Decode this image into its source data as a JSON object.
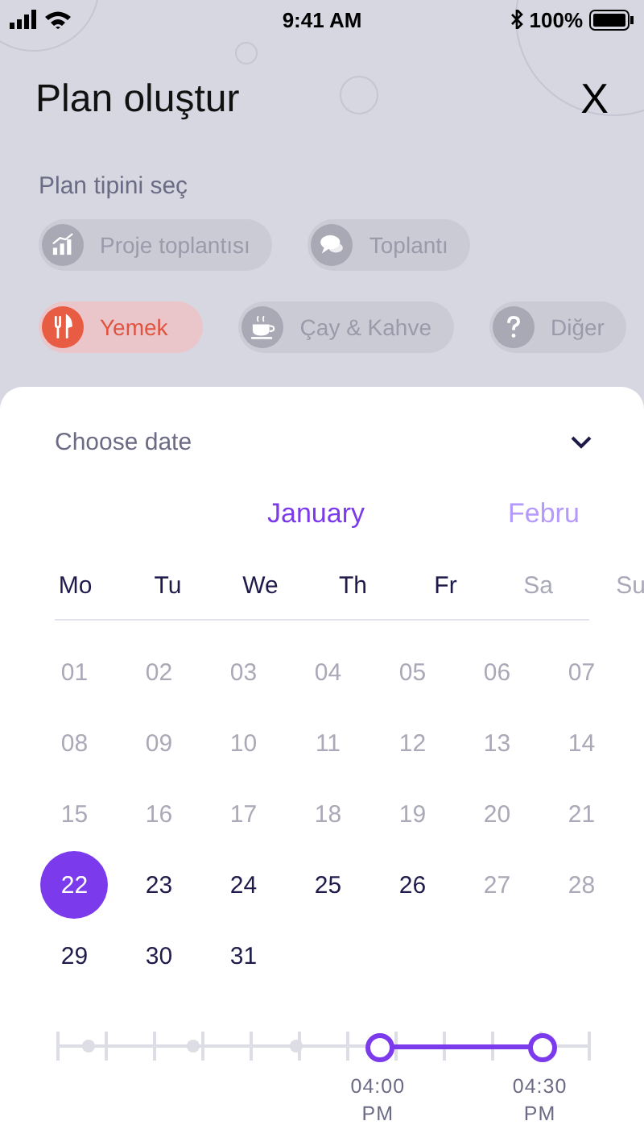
{
  "status_bar": {
    "time": "9:41 AM",
    "battery": "100%"
  },
  "header": {
    "title": "Plan oluştur",
    "close": "X"
  },
  "plan_type": {
    "label": "Plan tipini seç",
    "chips": [
      {
        "label": "Proje toplantısı",
        "kind": "chart",
        "selected": false
      },
      {
        "label": "Toplantı",
        "kind": "chat",
        "selected": false
      },
      {
        "label": "Yemek",
        "kind": "food",
        "selected": true
      },
      {
        "label": "Çay & Kahve",
        "kind": "cup",
        "selected": false
      },
      {
        "label": "Diğer",
        "kind": "other",
        "selected": false
      }
    ]
  },
  "date_sheet": {
    "title": "Choose date",
    "months": [
      {
        "label": "January",
        "selected": true
      },
      {
        "label": "Febru",
        "selected": false
      }
    ],
    "weekdays": [
      {
        "label": "Mo",
        "disabled": false
      },
      {
        "label": "Tu",
        "disabled": false
      },
      {
        "label": "We",
        "disabled": false
      },
      {
        "label": "Th",
        "disabled": false
      },
      {
        "label": "Fr",
        "disabled": false
      },
      {
        "label": "Sa",
        "disabled": true
      },
      {
        "label": "Su",
        "disabled": true
      }
    ],
    "days": [
      {
        "label": "01",
        "disabled": true,
        "selected": false
      },
      {
        "label": "02",
        "disabled": true,
        "selected": false
      },
      {
        "label": "03",
        "disabled": true,
        "selected": false
      },
      {
        "label": "04",
        "disabled": true,
        "selected": false
      },
      {
        "label": "05",
        "disabled": true,
        "selected": false
      },
      {
        "label": "06",
        "disabled": true,
        "selected": false
      },
      {
        "label": "07",
        "disabled": true,
        "selected": false
      },
      {
        "label": "08",
        "disabled": true,
        "selected": false
      },
      {
        "label": "09",
        "disabled": true,
        "selected": false
      },
      {
        "label": "10",
        "disabled": true,
        "selected": false
      },
      {
        "label": "11",
        "disabled": true,
        "selected": false
      },
      {
        "label": "12",
        "disabled": true,
        "selected": false
      },
      {
        "label": "13",
        "disabled": true,
        "selected": false
      },
      {
        "label": "14",
        "disabled": true,
        "selected": false
      },
      {
        "label": "15",
        "disabled": true,
        "selected": false
      },
      {
        "label": "16",
        "disabled": true,
        "selected": false
      },
      {
        "label": "17",
        "disabled": true,
        "selected": false
      },
      {
        "label": "18",
        "disabled": true,
        "selected": false
      },
      {
        "label": "19",
        "disabled": true,
        "selected": false
      },
      {
        "label": "20",
        "disabled": true,
        "selected": false
      },
      {
        "label": "21",
        "disabled": true,
        "selected": false
      },
      {
        "label": "22",
        "disabled": false,
        "selected": true
      },
      {
        "label": "23",
        "disabled": false,
        "selected": false
      },
      {
        "label": "24",
        "disabled": false,
        "selected": false
      },
      {
        "label": "25",
        "disabled": false,
        "selected": false
      },
      {
        "label": "26",
        "disabled": false,
        "selected": false
      },
      {
        "label": "27",
        "disabled": true,
        "selected": false
      },
      {
        "label": "28",
        "disabled": true,
        "selected": false
      },
      {
        "label": "29",
        "disabled": false,
        "selected": false
      },
      {
        "label": "30",
        "disabled": false,
        "selected": false
      },
      {
        "label": "31",
        "disabled": false,
        "selected": false
      }
    ],
    "time_range": {
      "start": {
        "level": 0.605,
        "time": "04:00",
        "period": "PM"
      },
      "end": {
        "level": 0.91,
        "time": "04:30",
        "period": "PM"
      }
    }
  }
}
